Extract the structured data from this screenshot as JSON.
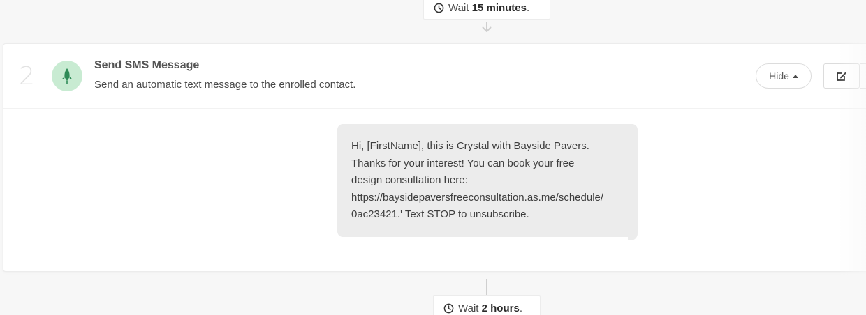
{
  "wait_before": {
    "prefix": "Wait",
    "duration": "15 minutes",
    "suffix": "."
  },
  "step": {
    "number": "2",
    "icon": "rocket-icon",
    "title": "Send SMS Message",
    "description": "Send an automatic text message to the enrolled contact.",
    "hide_label": "Hide",
    "message_lines": [
      "Hi, [FirstName], this is Crystal with Bayside Pavers.",
      "Thanks for your interest! You can book your free",
      "design consultation here:",
      "https://baysidepaversfreeconsultation.as.me/schedule/",
      "0ac23421.' Text STOP to unsubscribe."
    ]
  },
  "wait_after": {
    "prefix": "Wait",
    "duration": "2 hours",
    "suffix": "."
  },
  "colors": {
    "icon_bg": "#c8ebd2",
    "icon_fg": "#2e8b57",
    "bubble_bg": "#ececec",
    "page_bg": "#f7f7f7"
  }
}
